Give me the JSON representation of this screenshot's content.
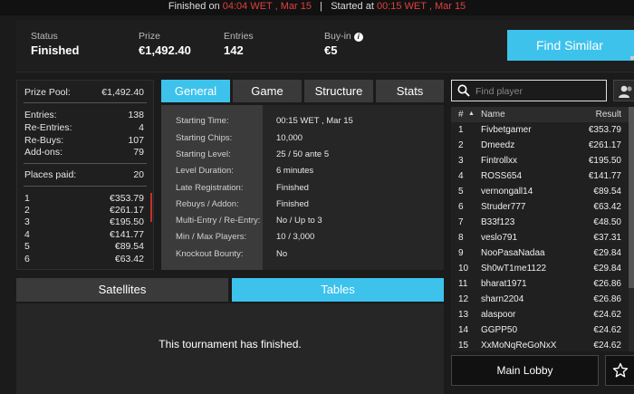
{
  "topbar": {
    "finished_prefix": "Finished on",
    "finished_time": "04:04 WET , Mar 15",
    "separator": "|",
    "started_prefix": "Started at",
    "started_time": "00:15 WET , Mar 15"
  },
  "header": {
    "status_label": "Status",
    "status_value": "Finished",
    "prize_label": "Prize",
    "prize_value": "€1,492.40",
    "entries_label": "Entries",
    "entries_value": "142",
    "buyin_label": "Buy-in",
    "buyin_value": "€5",
    "info_glyph": "i",
    "find_similar": "Find Similar"
  },
  "summary": {
    "prize_pool_label": "Prize Pool:",
    "prize_pool_value": "€1,492.40",
    "entries_label": "Entries:",
    "entries_value": "138",
    "reentries_label": "Re-Entries:",
    "reentries_value": "4",
    "rebuys_label": "Re-Buys:",
    "rebuys_value": "107",
    "addons_label": "Add-ons:",
    "addons_value": "79",
    "places_label": "Places paid:",
    "places_value": "20",
    "payouts": [
      {
        "place": "1",
        "amount": "€353.79"
      },
      {
        "place": "2",
        "amount": "€261.17"
      },
      {
        "place": "3",
        "amount": "€195.50"
      },
      {
        "place": "4",
        "amount": "€141.77"
      },
      {
        "place": "5",
        "amount": "€89.54"
      },
      {
        "place": "6",
        "amount": "€63.42"
      }
    ]
  },
  "tabs": [
    {
      "label": "General",
      "active": true
    },
    {
      "label": "Game",
      "active": false
    },
    {
      "label": "Structure",
      "active": false
    },
    {
      "label": "Stats",
      "active": false
    }
  ],
  "general": [
    {
      "label": "Starting Time:",
      "value": "00:15 WET , Mar 15"
    },
    {
      "label": "Starting Chips:",
      "value": "10,000"
    },
    {
      "label": "Starting Level:",
      "value": "25 / 50 ante 5"
    },
    {
      "label": "Level Duration:",
      "value": "6 minutes"
    },
    {
      "label": "Late Registration:",
      "value": "Finished"
    },
    {
      "label": "Rebuys / Addon:",
      "value": "Finished"
    },
    {
      "label": "Multi-Entry / Re-Entry:",
      "value": "No / Up to 3"
    },
    {
      "label": "Min / Max Players:",
      "value": "10 / 3,000"
    },
    {
      "label": "Knockout Bounty:",
      "value": "No"
    }
  ],
  "bottom_tabs": [
    {
      "label": "Satellites",
      "active": false
    },
    {
      "label": "Tables",
      "active": true
    }
  ],
  "finished_message": "This tournament has finished.",
  "search": {
    "placeholder": "Find player"
  },
  "results": {
    "headers": {
      "rank": "#",
      "sort_glyph": "▲",
      "name": "Name",
      "result": "Result"
    },
    "rows": [
      {
        "rank": "1",
        "name": "Fivbetgamer",
        "result": "€353.79"
      },
      {
        "rank": "2",
        "name": "Dmeedz",
        "result": "€261.17"
      },
      {
        "rank": "3",
        "name": "Fintrollxx",
        "result": "€195.50"
      },
      {
        "rank": "4",
        "name": "ROSS654",
        "result": "€141.77"
      },
      {
        "rank": "5",
        "name": "vernongall14",
        "result": "€89.54"
      },
      {
        "rank": "6",
        "name": "Struder777",
        "result": "€63.42"
      },
      {
        "rank": "7",
        "name": "B33f123",
        "result": "€48.50"
      },
      {
        "rank": "8",
        "name": "veslo791",
        "result": "€37.31"
      },
      {
        "rank": "9",
        "name": "NooPasaNadaa",
        "result": "€29.84"
      },
      {
        "rank": "10",
        "name": "Sh0wT1me1122",
        "result": "€29.84"
      },
      {
        "rank": "11",
        "name": "bharat1971",
        "result": "€26.86"
      },
      {
        "rank": "12",
        "name": "sharn2204",
        "result": "€26.86"
      },
      {
        "rank": "13",
        "name": "alaspoor",
        "result": "€24.62"
      },
      {
        "rank": "14",
        "name": "GGPP50",
        "result": "€24.62"
      },
      {
        "rank": "15",
        "name": "XxMoNqReGoNxX",
        "result": "€24.62"
      }
    ]
  },
  "main_lobby": "Main Lobby",
  "colors": {
    "accent": "#3dc2ec",
    "alert": "#e04040"
  }
}
